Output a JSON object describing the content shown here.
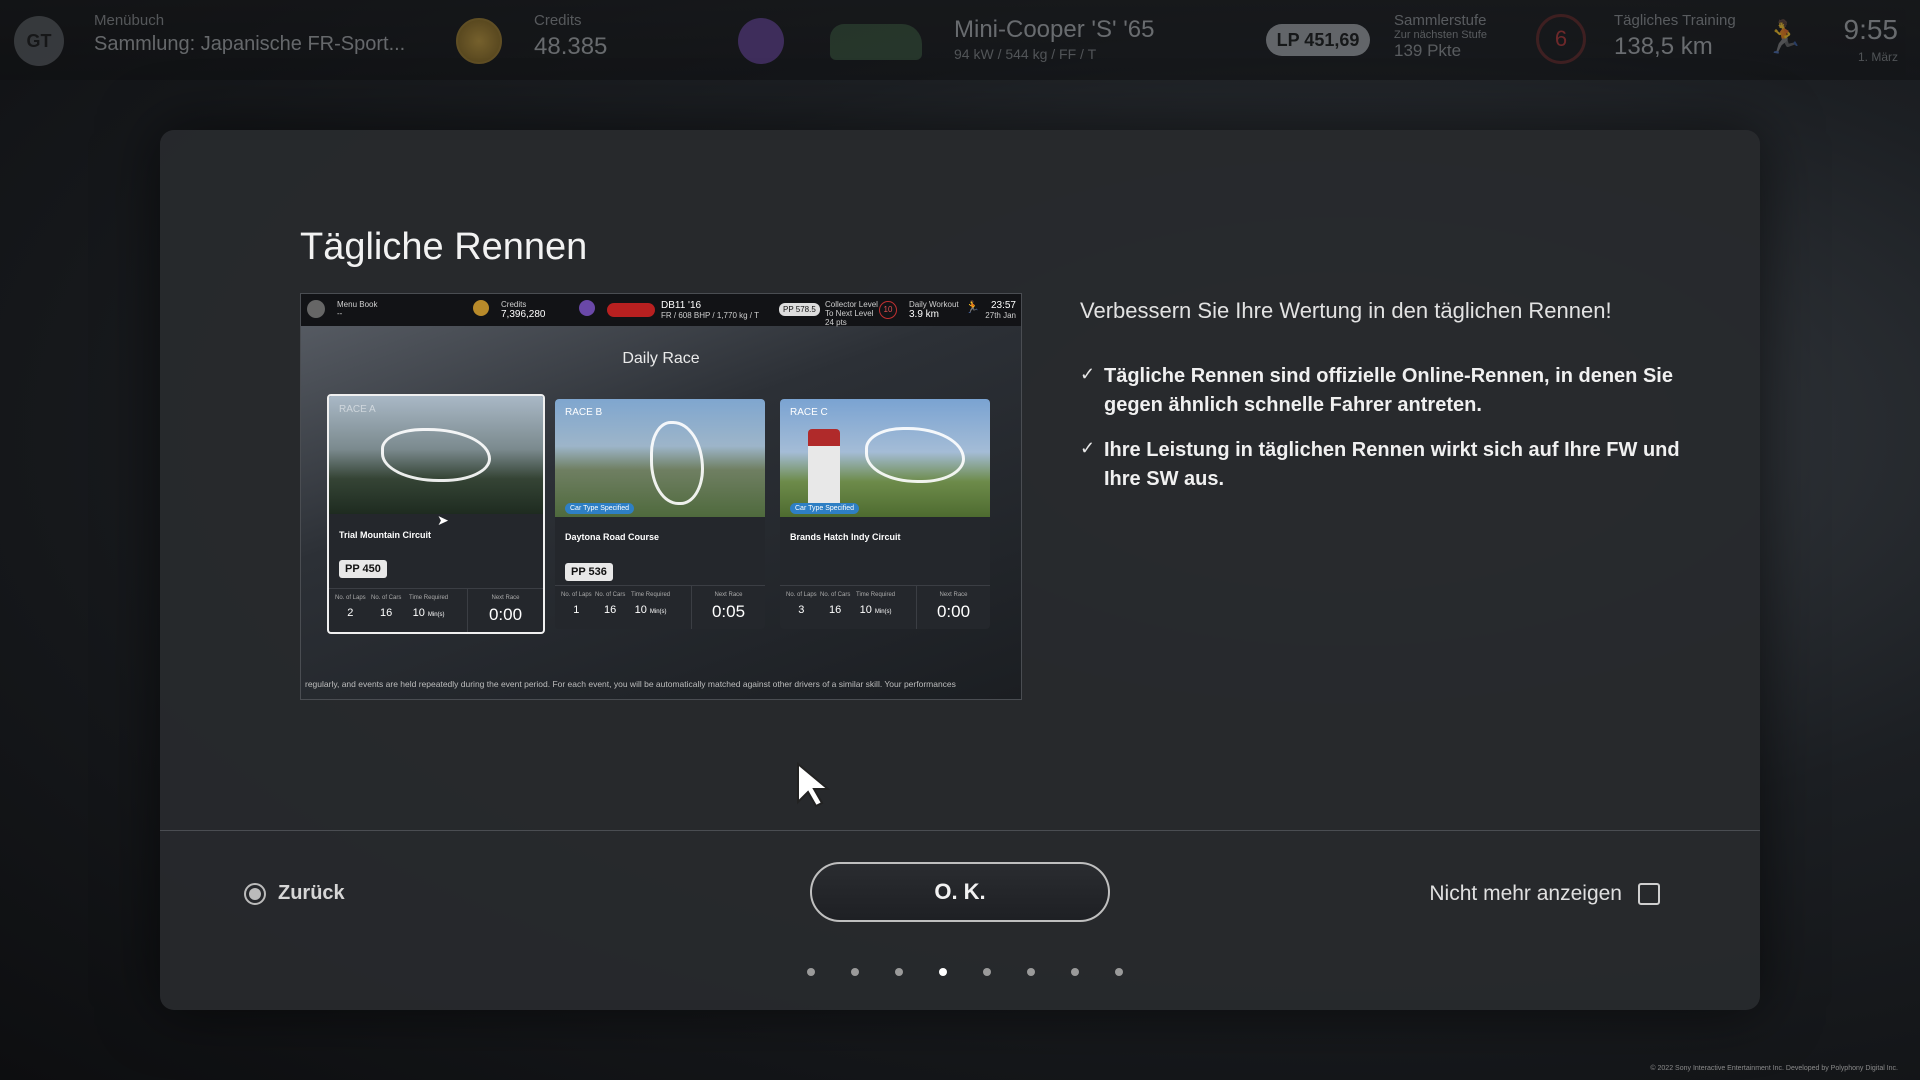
{
  "topbar": {
    "menu_label": "Menübuch",
    "menu_value": "Sammlung: Japanische FR-Sport...",
    "credits_label": "Credits",
    "credits_value": "48.385",
    "car_name": "Mini-Cooper 'S' '65",
    "car_specs": "94 kW / 544 kg / FF / T",
    "pp": "LP 451,69",
    "collector_label": "Sammlerstufe",
    "collector_sub": "Zur nächsten Stufe",
    "collector_value": "139 Pkte",
    "collector_level": "6",
    "training_label": "Tägliches Training",
    "training_value": "138,5 km",
    "time": "9:55",
    "date": "1. März"
  },
  "dialog": {
    "title": "Tägliche Rennen",
    "intro": "Verbessern Sie Ihre Wertung in den täglichen Rennen!",
    "bullets": [
      "Tägliche Rennen sind offizielle Online-Rennen, in denen Sie gegen ähnlich schnelle Fahrer antreten.",
      "Ihre Leistung in täglichen Rennen wirkt sich auf Ihre FW und Ihre SW aus."
    ],
    "back_label": "Zurück",
    "ok_label": "O. K.",
    "dont_show_label": "Nicht mehr anzeigen",
    "page_count": 8,
    "active_page": 4
  },
  "preview": {
    "topbar": {
      "menu_label": "Menu Book",
      "menu_value": "--",
      "credits_label": "Credits",
      "credits_value": "7,396,280",
      "car_name": "DB11 '16",
      "car_specs": "FR / 608 BHP / 1,770 kg / T",
      "pp": "PP 578.5",
      "collector_label": "Collector Level",
      "collector_sub": "To Next Level",
      "collector_value": "24 pts",
      "collector_level": "10",
      "workout_label": "Daily Workout",
      "workout_value": "3.9 km",
      "time": "23:57",
      "date": "27th Jan"
    },
    "title": "Daily Race",
    "cards": [
      {
        "race_label": "RACE A",
        "track": "Trial Mountain Circuit",
        "pp": "PP 450",
        "laps_label": "No. of Laps",
        "laps": "2",
        "cars_label": "No. of Cars",
        "cars": "16",
        "time_label": "Time Required",
        "time": "10",
        "time_unit": "Min(s)",
        "next_label": "Next Race",
        "next": "0:00"
      },
      {
        "race_label": "RACE B",
        "spec": "Car Type Specified",
        "track": "Daytona Road Course",
        "pp": "PP 536",
        "laps_label": "No. of Laps",
        "laps": "1",
        "cars_label": "No. of Cars",
        "cars": "16",
        "time_label": "Time Required",
        "time": "10",
        "time_unit": "Min(s)",
        "next_label": "Next Race",
        "next": "0:05"
      },
      {
        "race_label": "RACE C",
        "spec": "Car Type Specified",
        "track": "Brands Hatch Indy Circuit",
        "laps_label": "No. of Laps",
        "laps": "3",
        "cars_label": "No. of Cars",
        "cars": "16",
        "time_label": "Time Required",
        "time": "10",
        "time_unit": "Min(s)",
        "next_label": "Next Race",
        "next": "0:00"
      }
    ],
    "footer_text": "regularly, and events are held repeatedly during the event period. For each event, you will be automatically matched against other drivers of a similar skill. Your performances"
  },
  "copyright": "© 2022 Sony Interactive Entertainment Inc. Developed by Polyphony Digital Inc."
}
